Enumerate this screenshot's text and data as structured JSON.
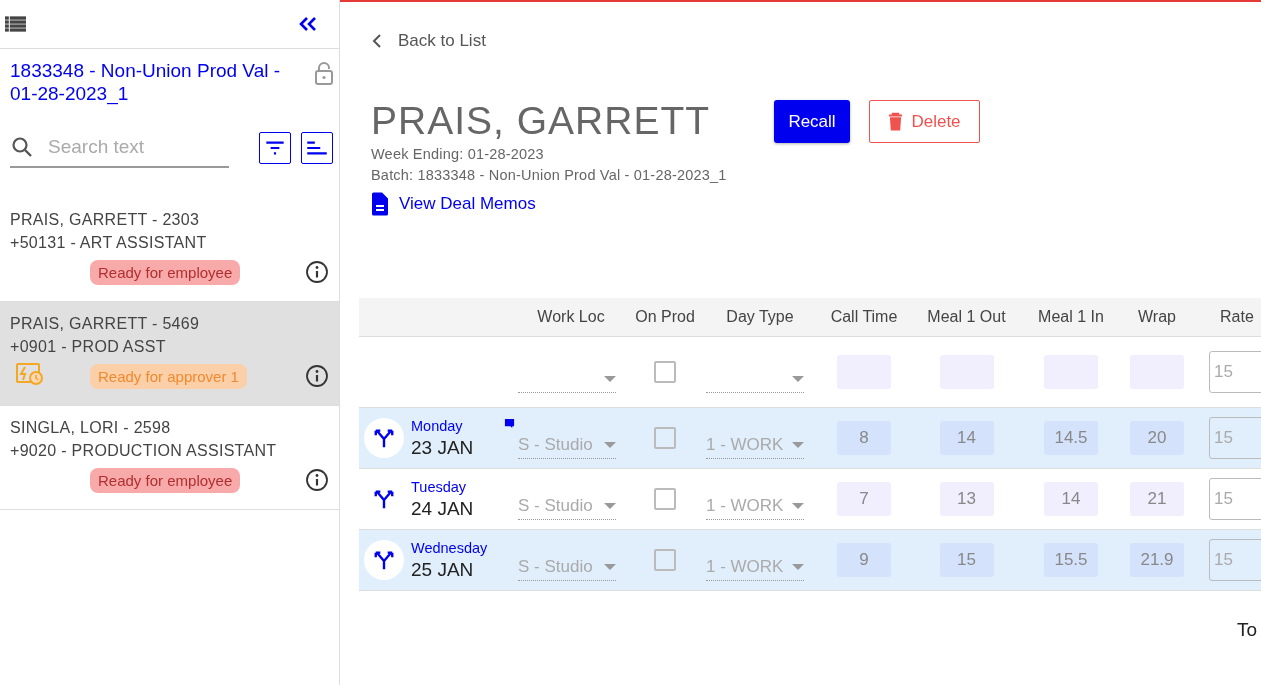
{
  "sidebar": {
    "batch_title": "1833348 - Non-Union Prod Val - 01-28-2023_1",
    "search": {
      "placeholder": "Search text"
    },
    "items": [
      {
        "title": "PRAIS, GARRETT - 2303",
        "subtitle": "+50131 - ART ASSISTANT",
        "status": {
          "label": "Ready for employee",
          "kind": "employee"
        },
        "flagged": false,
        "selected": false
      },
      {
        "title": "PRAIS, GARRETT - 5469",
        "subtitle": "+0901 - PROD ASST",
        "status": {
          "label": "Ready for approver 1",
          "kind": "approver"
        },
        "flagged": true,
        "selected": true
      },
      {
        "title": "SINGLA, LORI - 2598",
        "subtitle": "+9020 - PRODUCTION ASSISTANT",
        "status": {
          "label": "Ready for employee",
          "kind": "employee"
        },
        "flagged": false,
        "selected": false
      }
    ]
  },
  "back_link": "Back to List",
  "header": {
    "name": "PRAIS, GARRETT",
    "week_ending": "Week Ending: 01-28-2023",
    "batch": "Batch: 1833348 - Non-Union Prod Val - 01-28-2023_1",
    "deal_memos_link": "View Deal Memos",
    "recall_button": "Recall",
    "delete_button": "Delete"
  },
  "table": {
    "columns": [
      "Work Loc",
      "On Prod",
      "Day Type",
      "Call Time",
      "Meal 1 Out",
      "Meal 1 In",
      "Wrap",
      "Rate"
    ],
    "rows": [
      {
        "kind": "template",
        "on_prod": false,
        "highlighted": false,
        "rate": "15"
      },
      {
        "kind": "day",
        "weekday": "Monday",
        "date": "23 JAN",
        "has_note": true,
        "work_loc": "S - Studio",
        "on_prod": false,
        "day_type": "1 - WORK",
        "times": [
          "8",
          "14",
          "14.5",
          "20"
        ],
        "rate": "15",
        "highlighted": true
      },
      {
        "kind": "day",
        "weekday": "Tuesday",
        "date": "24 JAN",
        "has_note": false,
        "work_loc": "S - Studio",
        "on_prod": false,
        "day_type": "1 - WORK",
        "times": [
          "7",
          "13",
          "14",
          "21"
        ],
        "rate": "15",
        "highlighted": false
      },
      {
        "kind": "day",
        "weekday": "Wednesday",
        "date": "25 JAN",
        "has_note": false,
        "work_loc": "S - Studio",
        "on_prod": false,
        "day_type": "1 - WORK",
        "times": [
          "9",
          "15",
          "15.5",
          "21.9"
        ],
        "rate": "15",
        "highlighted": true
      }
    ]
  },
  "footer_label": "To"
}
